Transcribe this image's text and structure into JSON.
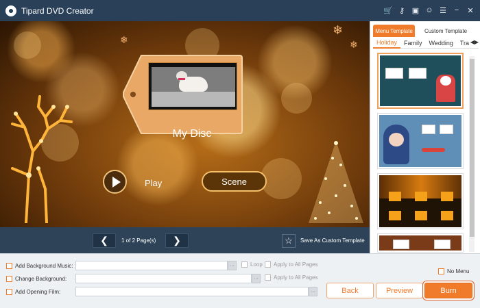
{
  "app": {
    "title": "Tipard DVD Creator"
  },
  "titlebar_icons": [
    "cart-icon",
    "key-icon",
    "save-icon",
    "feedback-icon",
    "menu-icon",
    "minimize-icon",
    "close-icon"
  ],
  "preview": {
    "disc_title": "My Disc",
    "play_label": "Play",
    "scene_label": "Scene"
  },
  "pager": {
    "prev_glyph": "❮",
    "next_glyph": "❯",
    "page_text": "1 of 2 Page(s)",
    "save_template_label": "Save As Custom Template"
  },
  "right_panel": {
    "tabs": {
      "menu_template": "Menu Template",
      "custom_template": "Custom Template"
    },
    "categories": [
      "Holiday",
      "Family",
      "Wedding",
      "Tra"
    ],
    "active_category": "Holiday"
  },
  "bottom": {
    "add_background_music": "Add Background Music:",
    "change_background": "Change Background:",
    "add_opening_film": "Add Opening Film:",
    "loop": "Loop",
    "apply_all_pages": "Apply to All Pages",
    "ellipsis": "···",
    "no_menu": "No Menu"
  },
  "buttons": {
    "back": "Back",
    "preview": "Preview",
    "burn": "Burn"
  },
  "colors": {
    "accent": "#f07b2a",
    "titlebar": "#2a4059",
    "pager": "#2e4358"
  }
}
